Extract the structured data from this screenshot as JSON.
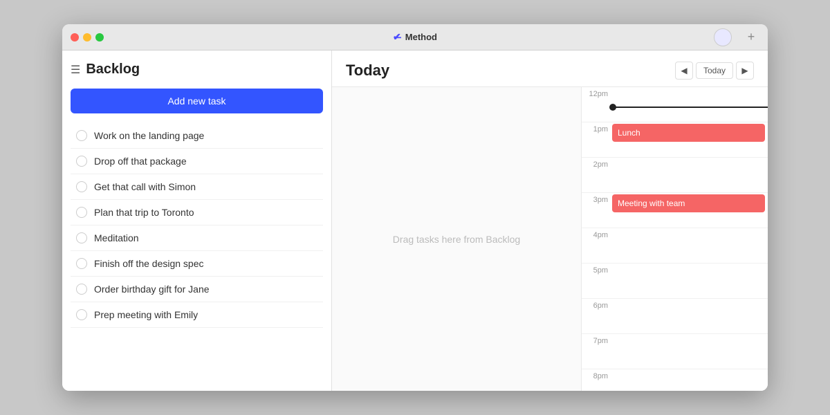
{
  "app": {
    "title": "Method",
    "title_icon": "✔",
    "add_tab_label": "+"
  },
  "sidebar": {
    "title": "Backlog",
    "menu_icon": "☰",
    "add_task_label": "Add new task",
    "tasks": [
      {
        "id": 1,
        "label": "Work on the landing page",
        "done": false
      },
      {
        "id": 2,
        "label": "Drop off that package",
        "done": false
      },
      {
        "id": 3,
        "label": "Get that call with Simon",
        "done": false
      },
      {
        "id": 4,
        "label": "Plan that trip to Toronto",
        "done": false
      },
      {
        "id": 5,
        "label": "Meditation",
        "done": false
      },
      {
        "id": 6,
        "label": "Finish off the design spec",
        "done": false
      },
      {
        "id": 7,
        "label": "Order birthday gift for Jane",
        "done": false
      },
      {
        "id": 8,
        "label": "Prep meeting with Emily",
        "done": false
      }
    ]
  },
  "main": {
    "today_title": "Today",
    "today_button": "Today",
    "drop_hint": "Drag tasks here from Backlog",
    "nav_prev": "◀",
    "nav_next": "▶"
  },
  "calendar": {
    "time_slots": [
      {
        "label": "12pm",
        "events": [],
        "has_line": true
      },
      {
        "label": "1pm",
        "events": [
          {
            "title": "Lunch",
            "color": "event-red"
          }
        ]
      },
      {
        "label": "2pm",
        "events": []
      },
      {
        "label": "3pm",
        "events": [
          {
            "title": "Meeting with team",
            "color": "event-red"
          }
        ]
      },
      {
        "label": "4pm",
        "events": []
      },
      {
        "label": "5pm",
        "events": []
      },
      {
        "label": "6pm",
        "events": []
      },
      {
        "label": "7pm",
        "events": []
      },
      {
        "label": "8pm",
        "events": []
      }
    ]
  },
  "colors": {
    "add_task_bg": "#3355ff",
    "event_red": "#f56565"
  }
}
